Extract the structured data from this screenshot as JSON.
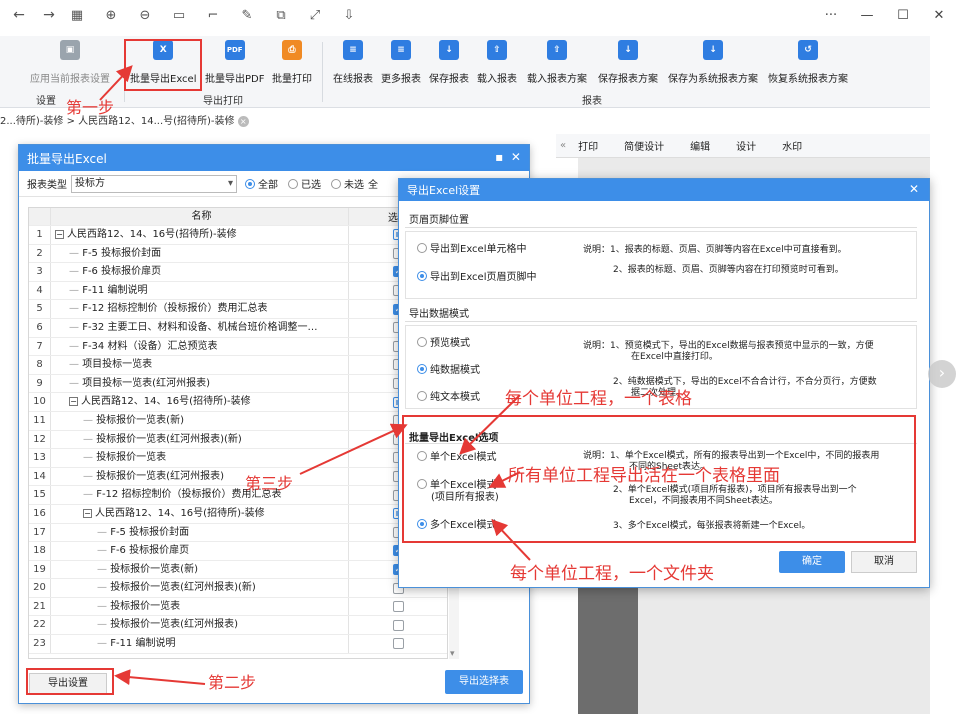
{
  "titlebar": {
    "icons": [
      "back-arrow-icon",
      "forward-arrow-icon",
      "grid-icon",
      "zoom-in-icon",
      "zoom-out-icon",
      "fit-icon",
      "crop-icon",
      "edit-icon",
      "copy-icon",
      "fullscreen-icon",
      "save-icon"
    ],
    "more": "···",
    "minimize": "—",
    "maximize": "☐",
    "close": "✕"
  },
  "ribbon": {
    "buttons": [
      {
        "label": "应用当前报表设置",
        "color": "#9aa4ad",
        "glyph": "▣"
      },
      {
        "label": "批量导出Excel",
        "color": "#2f7de1",
        "glyph": "X"
      },
      {
        "label": "批量导出PDF",
        "color": "#2f7de1",
        "glyph": "PDF"
      },
      {
        "label": "批量打印",
        "color": "#f08a24",
        "glyph": "⎙"
      },
      {
        "label": "在线报表",
        "color": "#2f7de1",
        "glyph": "≡"
      },
      {
        "label": "更多报表",
        "color": "#2f7de1",
        "glyph": "≡"
      },
      {
        "label": "保存报表",
        "color": "#2f7de1",
        "glyph": "↓"
      },
      {
        "label": "载入报表",
        "color": "#2f7de1",
        "glyph": "⇧"
      },
      {
        "label": "载入报表方案",
        "color": "#2f7de1",
        "glyph": "⇧"
      },
      {
        "label": "保存报表方案",
        "color": "#2f7de1",
        "glyph": "↓"
      },
      {
        "label": "保存为系统报表方案",
        "color": "#2f7de1",
        "glyph": "↓"
      },
      {
        "label": "恢复系统报表方案",
        "color": "#2f7de1",
        "glyph": "↺"
      }
    ],
    "groups": [
      "设置",
      "导出打印",
      "报表"
    ]
  },
  "breadcrumb": "2...待所)-装修 > 人民西路12、14...号(招待所)-装修",
  "subbar": [
    "打印",
    "简便设计",
    "编辑",
    "设计",
    "水印"
  ],
  "dialog1": {
    "title": "批量导出Excel",
    "report_type_label": "报表类型",
    "report_type_value": "投标方",
    "filters": [
      "全部",
      "已选",
      "未选",
      "全"
    ],
    "col_name": "名称",
    "col_select": "选择",
    "rows": [
      {
        "n": "1",
        "name": "人民西路12、14、16号(招待所)-装修",
        "indent": 0,
        "tog": "−",
        "sel": "part"
      },
      {
        "n": "2",
        "name": "F-5 投标报价封面",
        "indent": 1,
        "sel": "off"
      },
      {
        "n": "3",
        "name": "F-6 投标报价扉页",
        "indent": 1,
        "sel": "on"
      },
      {
        "n": "4",
        "name": "F-11 编制说明",
        "indent": 1,
        "sel": "off"
      },
      {
        "n": "5",
        "name": "F-12 招标控制价（投标报价）费用汇总表",
        "indent": 1,
        "sel": "on"
      },
      {
        "n": "6",
        "name": "F-32 主要工日、材料和设备、机械台班价格调整一…",
        "indent": 1,
        "sel": "off"
      },
      {
        "n": "7",
        "name": "F-34 材料（设备）汇总预览表",
        "indent": 1,
        "sel": "off"
      },
      {
        "n": "8",
        "name": "项目投标一览表",
        "indent": 1,
        "sel": "off"
      },
      {
        "n": "9",
        "name": "项目投标一览表(红河州报表)",
        "indent": 1,
        "sel": "off"
      },
      {
        "n": "10",
        "name": "人民西路12、14、16号(招待所)-装修",
        "indent": 1,
        "tog": "−",
        "sel": "part"
      },
      {
        "n": "11",
        "name": "投标报价一览表(新)",
        "indent": 2,
        "sel": "off"
      },
      {
        "n": "12",
        "name": "投标报价一览表(红河州报表)(新)",
        "indent": 2,
        "sel": "off"
      },
      {
        "n": "13",
        "name": "投标报价一览表",
        "indent": 2,
        "sel": "off"
      },
      {
        "n": "14",
        "name": "投标报价一览表(红河州报表)",
        "indent": 2,
        "sel": "off"
      },
      {
        "n": "15",
        "name": "F-12 招标控制价（投标报价）费用汇总表",
        "indent": 2,
        "sel": "off"
      },
      {
        "n": "16",
        "name": "人民西路12、14、16号(招待所)-装修",
        "indent": 2,
        "tog": "−",
        "sel": "part"
      },
      {
        "n": "17",
        "name": "F-5 投标报价封面",
        "indent": 3,
        "sel": "off"
      },
      {
        "n": "18",
        "name": "F-6 投标报价扉页",
        "indent": 3,
        "sel": "on"
      },
      {
        "n": "19",
        "name": "投标报价一览表(新)",
        "indent": 3,
        "sel": "on"
      },
      {
        "n": "20",
        "name": "投标报价一览表(红河州报表)(新)",
        "indent": 3,
        "sel": "off"
      },
      {
        "n": "21",
        "name": "投标报价一览表",
        "indent": 3,
        "sel": "off"
      },
      {
        "n": "22",
        "name": "投标报价一览表(红河州报表)",
        "indent": 3,
        "sel": "off"
      },
      {
        "n": "23",
        "name": "F-11 编制说明",
        "indent": 3,
        "sel": "off"
      }
    ],
    "btn_settings": "导出设置",
    "btn_export": "导出选择表"
  },
  "dialog2": {
    "title": "导出Excel设置",
    "sec1": "页眉页脚位置",
    "sec1_opts": [
      "导出到Excel单元格中",
      "导出到Excel页眉页脚中"
    ],
    "sec1_notes": [
      "说明：1、报表的标题、页眉、页脚等内容在Excel中可直接看到。",
      "2、报表的标题、页眉、页脚等内容在打印预览时可看到。"
    ],
    "sec2": "导出数据模式",
    "sec2_opts": [
      "预览模式",
      "纯数据模式",
      "纯文本模式"
    ],
    "sec2_notes": [
      "说明：1、预览模式下，导出的Excel数据与报表预览中显示的一致，方便",
      "在Excel中直接打印。",
      "2、纯数据模式下，导出的Excel不合合计行，不合分页行，方便数",
      "据二次处理。"
    ],
    "sec3": "批量导出Excel选项",
    "sec3_opts": [
      "单个Excel模式",
      "单个Excel模式",
      "(项目所有报表)",
      "多个Excel模式"
    ],
    "sec3_notes": [
      "说明：1、单个Excel模式，所有的报表导出到一个Excel中，不同的报表用",
      "不同的Sheet表达。",
      "2、单个Excel模式(项目所有报表)，项目所有报表导出到一个",
      "Excel，不同报表用不同Sheet表达。",
      "3、多个Excel模式，每张报表将新建一个Excel。"
    ],
    "btn_ok": "确定",
    "btn_cancel": "取消"
  },
  "annotations": {
    "step1": "第一步",
    "step2": "第二步",
    "step3": "第三步",
    "a1": "每个单位工程，一个表格",
    "a2": "所有单位工程导出活在一个表格里面",
    "a3": "每个单位工程，一个文件夹",
    "accent": "#e53935"
  }
}
